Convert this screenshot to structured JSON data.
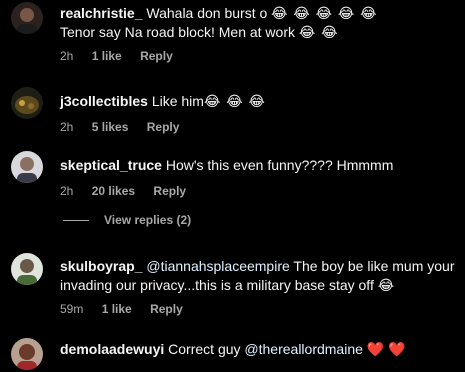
{
  "comments": [
    {
      "username": "realchristie_",
      "text_line1": "Wahala don burst o",
      "emoji_line1": "😂 😂 😂 😂 😂",
      "text_line2": "Tenor say Na road block! Men at work",
      "emoji_line2": "😂 😂",
      "time": "2h",
      "likes": "1 like",
      "reply": "Reply",
      "avatar_color": "#3a2c2a"
    },
    {
      "username": "j3collectibles",
      "text": "Like him",
      "emoji": "😂 😂 😂",
      "time": "2h",
      "likes": "5 likes",
      "reply": "Reply",
      "avatar_color": "#2a2f1c"
    },
    {
      "username": "skeptical_truce",
      "text": "How's this even funny???? Hmmmm",
      "time": "2h",
      "likes": "20 likes",
      "reply": "Reply",
      "avatar_color": "#4a4a55"
    },
    {
      "username": "skulboyrap_",
      "mention": "@tiannahsplaceempire",
      "text_line1": "The boy be like mum your",
      "text_line2": "invading our privacy...this is a military base stay off",
      "emoji_line2": "😂",
      "time": "59m",
      "likes": "1 like",
      "reply": "Reply",
      "avatar_color": "#3c4a3c"
    },
    {
      "username": "demolaadewuyi",
      "text": "Correct guy",
      "mention": "@thereallordmaine",
      "hearts": "❤️ ❤️",
      "avatar_color": "#5a3a2c"
    }
  ],
  "view_replies": "View replies (2)"
}
